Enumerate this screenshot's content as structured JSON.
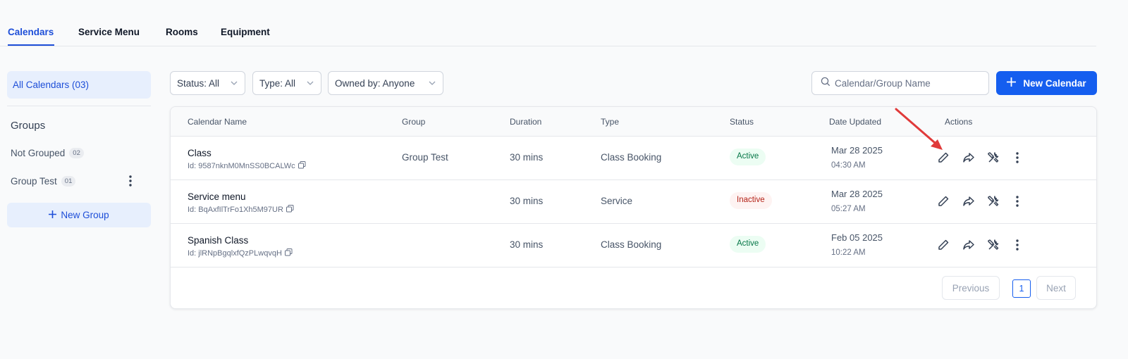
{
  "tabs": [
    {
      "label": "Calendars",
      "active": true
    },
    {
      "label": "Service Menu",
      "active": false
    },
    {
      "label": "Rooms",
      "active": false
    },
    {
      "label": "Equipment",
      "active": false
    }
  ],
  "sidebar": {
    "all_calendars": "All Calendars (03)",
    "groups_heading": "Groups",
    "groups": [
      {
        "name": "Not Grouped",
        "count": "02"
      },
      {
        "name": "Group Test",
        "count": "01"
      }
    ],
    "new_group": "New Group"
  },
  "filters": {
    "status": "Status: All",
    "type": "Type: All",
    "owned_by": "Owned by: Anyone"
  },
  "search": {
    "placeholder": "Calendar/Group Name"
  },
  "new_calendar": "New Calendar",
  "table": {
    "columns": [
      "Calendar Name",
      "Group",
      "Duration",
      "Type",
      "Status",
      "Date Updated",
      "Actions"
    ],
    "rows": [
      {
        "name": "Class",
        "id": "Id: 9587nknM0MnSS0BCALWc",
        "group": "Group Test",
        "duration": "30 mins",
        "type": "Class Booking",
        "status": "Active",
        "date": "Mar 28 2025",
        "time": "04:30 AM"
      },
      {
        "name": "Service menu",
        "id": "Id: BqAxfIlTrFo1Xh5M97UR",
        "group": "",
        "duration": "30 mins",
        "type": "Service",
        "status": "Inactive",
        "date": "Mar 28 2025",
        "time": "05:27 AM"
      },
      {
        "name": "Spanish Class",
        "id": "Id: jlRNpBgqlxfQzPLwqvqH",
        "group": "",
        "duration": "30 mins",
        "type": "Class Booking",
        "status": "Active",
        "date": "Feb 05 2025",
        "time": "10:22 AM"
      }
    ]
  },
  "pagination": {
    "previous": "Previous",
    "page": "1",
    "next": "Next"
  },
  "colors": {
    "accent": "#155eef",
    "active_text": "#067647",
    "inactive_text": "#b42318",
    "annotation_arrow": "#e03a3a"
  }
}
